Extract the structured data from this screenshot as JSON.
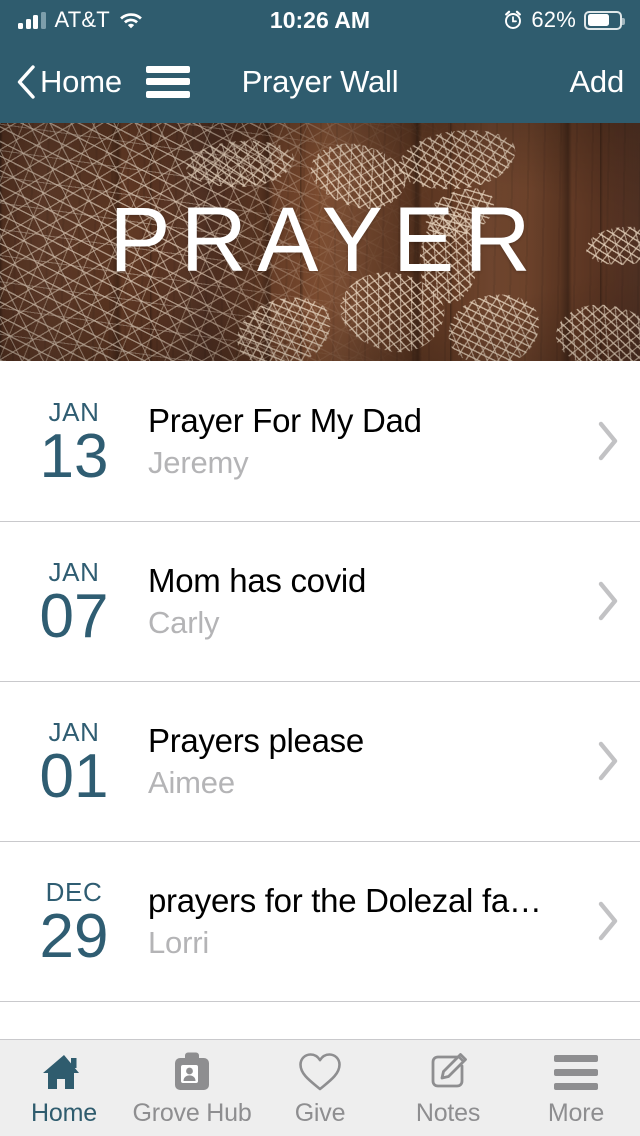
{
  "status_bar": {
    "carrier": "AT&T",
    "time": "10:26 AM",
    "battery_percent": "62%",
    "battery_level": 62,
    "signal_bars": 3,
    "icons": [
      "signal-icon",
      "wifi-icon",
      "alarm-icon",
      "battery-icon"
    ]
  },
  "nav_bar": {
    "back_label": "Home",
    "title": "Prayer Wall",
    "action_label": "Add",
    "background_color": "#2f5c6e"
  },
  "hero": {
    "title": "PRAYER"
  },
  "list": {
    "items": [
      {
        "month": "JAN",
        "day": "13",
        "title": "Prayer For My Dad",
        "author": "Jeremy"
      },
      {
        "month": "JAN",
        "day": "07",
        "title": "Mom has covid",
        "author": "Carly"
      },
      {
        "month": "JAN",
        "day": "01",
        "title": "Prayers please",
        "author": "Aimee"
      },
      {
        "month": "DEC",
        "day": "29",
        "title": "prayers for the Dolezal fa…",
        "author": "Lorri"
      }
    ]
  },
  "tab_bar": {
    "items": [
      {
        "label": "Home",
        "icon": "home-icon",
        "active": true
      },
      {
        "label": "Grove Hub",
        "icon": "clipboard-person-icon",
        "active": false
      },
      {
        "label": "Give",
        "icon": "heart-icon",
        "active": false
      },
      {
        "label": "Notes",
        "icon": "note-pencil-icon",
        "active": false
      },
      {
        "label": "More",
        "icon": "hamburger-icon",
        "active": false
      }
    ],
    "active_color": "#2f5c6e",
    "inactive_color": "#8e8e90"
  }
}
